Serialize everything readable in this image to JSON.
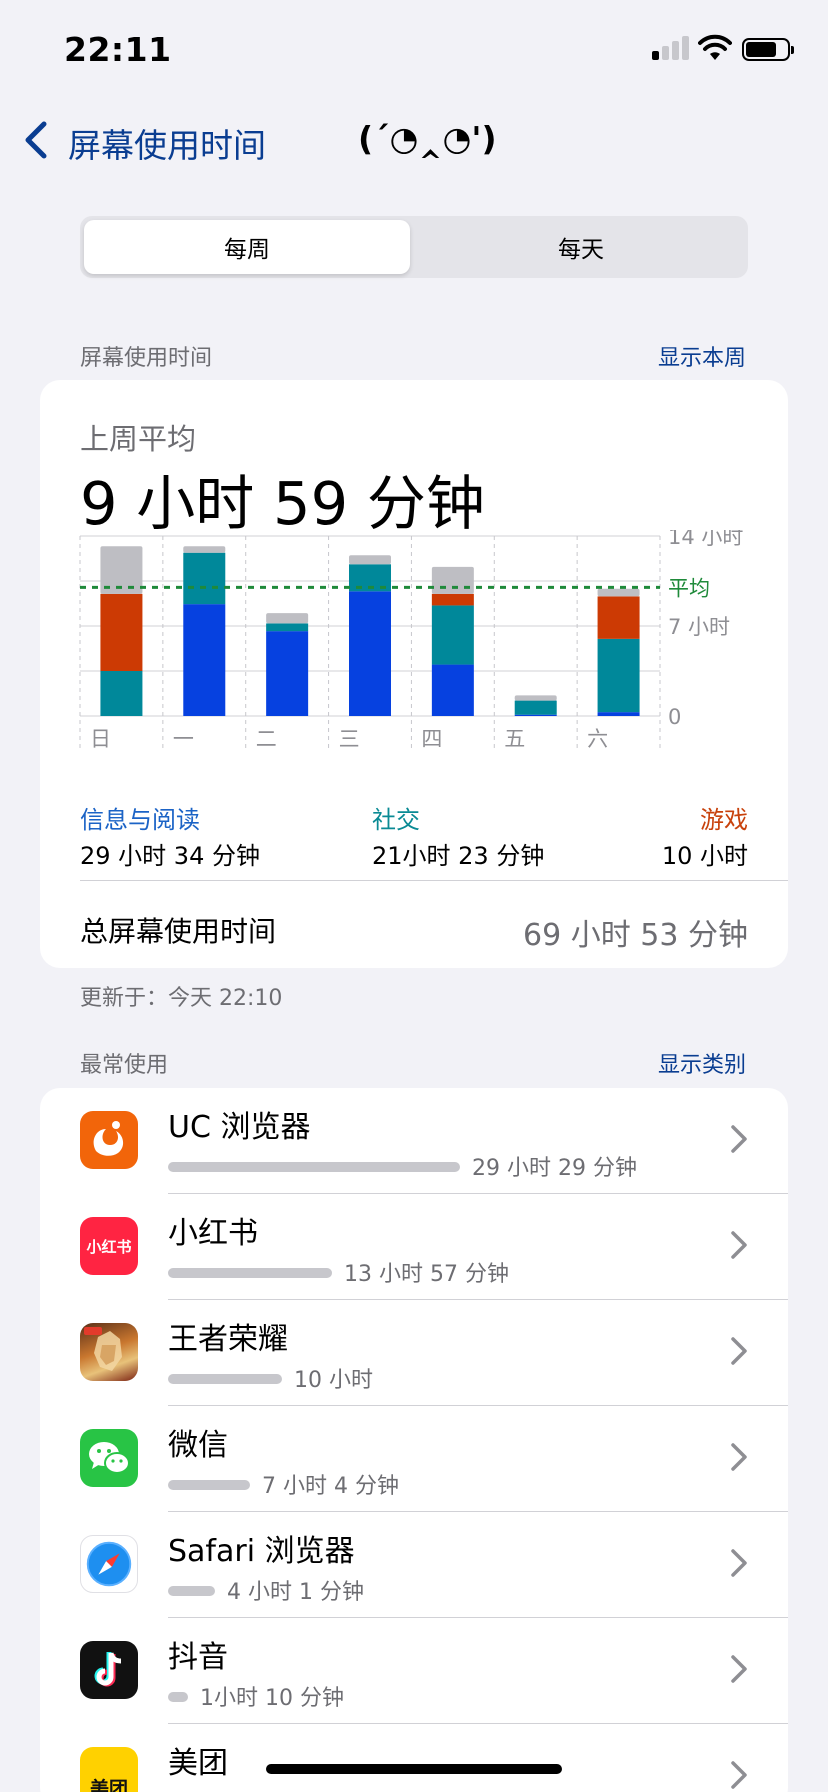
{
  "status": {
    "time": "22:11"
  },
  "nav": {
    "back_label": "屏幕使用时间",
    "kaomoji": "(´◔‸◔')"
  },
  "segments": {
    "weekly": "每周",
    "daily": "每天",
    "selected": "每周"
  },
  "usage_section": {
    "label": "屏幕使用时间",
    "link": "显示本周"
  },
  "summary": {
    "avg_label": "上周平均",
    "avg_value": "9 小时 59 分钟",
    "categories": [
      {
        "label": "信息与阅读",
        "value": "29 小时 34 分钟",
        "color": "#1b63c6"
      },
      {
        "label": "社交",
        "value": "21小时 23 分钟",
        "color": "#0a8a94"
      },
      {
        "label": "游戏",
        "value": "10 小时",
        "color": "#c8420c"
      }
    ],
    "total_label": "总屏幕使用时间",
    "total_value": "69 小时 53 分钟"
  },
  "chart_data": {
    "type": "bar",
    "stacked": true,
    "categories": [
      "日",
      "一",
      "二",
      "三",
      "四",
      "五",
      "六"
    ],
    "series": [
      {
        "name": "信息与阅读",
        "color": "#0641e0",
        "values": [
          0,
          8.7,
          6.6,
          9.7,
          4.0,
          0.1,
          0.3
        ]
      },
      {
        "name": "社交",
        "color": "#00889a",
        "values": [
          3.5,
          4.0,
          0.6,
          2.1,
          4.6,
          1.1,
          5.7
        ]
      },
      {
        "name": "游戏",
        "color": "#cc3a04",
        "values": [
          6.0,
          0,
          0,
          0,
          0.9,
          0,
          3.3
        ]
      },
      {
        "name": "",
        "color": "#bebec3",
        "values": [
          3.7,
          0.5,
          0.8,
          0.7,
          2.1,
          0.4,
          0.6
        ]
      }
    ],
    "average": 10.0,
    "average_label": "平均",
    "average_color": "#1f8a3a",
    "y_ticks": [
      {
        "value": 14,
        "label": "14 小时"
      },
      {
        "value": 7,
        "label": "7 小时"
      },
      {
        "value": 0,
        "label": "0"
      }
    ],
    "ylim": [
      0,
      14
    ],
    "grid": true
  },
  "updated": "更新于：今天 22:10",
  "most_used": {
    "label": "最常使用",
    "link": "显示类别",
    "apps": [
      {
        "name": "UC 浏览器",
        "time": "29 小时 29 分钟",
        "fraction": 1.0,
        "icon": "uc-browser-icon"
      },
      {
        "name": "小红书",
        "time": "13 小时 57 分钟",
        "fraction": 0.56,
        "icon": "xiaohongshu-icon",
        "icon_text": "小红书"
      },
      {
        "name": "王者荣耀",
        "time": "10 小时",
        "fraction": 0.39,
        "icon": "honor-of-kings-icon"
      },
      {
        "name": "微信",
        "time": "7 小时 4 分钟",
        "fraction": 0.28,
        "icon": "wechat-icon"
      },
      {
        "name": "Safari 浏览器",
        "time": "4 小时 1 分钟",
        "fraction": 0.16,
        "icon": "safari-icon"
      },
      {
        "name": "抖音",
        "time": "1小时 10 分钟",
        "fraction": 0.06,
        "icon": "douyin-icon"
      },
      {
        "name": "美团",
        "time": "",
        "fraction": 0.06,
        "icon": "meituan-icon",
        "icon_text": "美团"
      }
    ]
  }
}
